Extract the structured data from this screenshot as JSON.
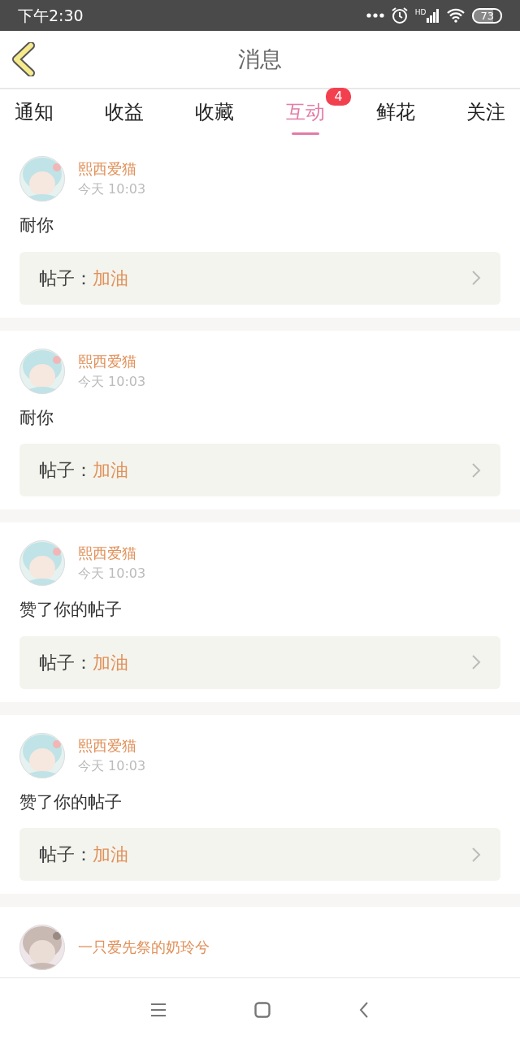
{
  "status_bar": {
    "time": "下午2:30",
    "network_label": "HD",
    "battery": "73"
  },
  "header": {
    "title": "消息"
  },
  "tabs": [
    {
      "label": "通知",
      "selected": false
    },
    {
      "label": "收益",
      "selected": false
    },
    {
      "label": "收藏",
      "selected": false
    },
    {
      "label": "互动",
      "selected": true,
      "badge": "4"
    },
    {
      "label": "鲜花",
      "selected": false
    },
    {
      "label": "关注",
      "selected": false
    }
  ],
  "messages": [
    {
      "user": "熙西爱猫",
      "time": "今天 10:03",
      "text": "耐你",
      "post_label": "帖子：",
      "post_title": "加油"
    },
    {
      "user": "熙西爱猫",
      "time": "今天 10:03",
      "text": "耐你",
      "post_label": "帖子：",
      "post_title": "加油"
    },
    {
      "user": "熙西爱猫",
      "time": "今天 10:03",
      "text": "赞了你的帖子",
      "post_label": "帖子：",
      "post_title": "加油"
    },
    {
      "user": "熙西爱猫",
      "time": "今天 10:03",
      "text": "赞了你的帖子",
      "post_label": "帖子：",
      "post_title": "加油"
    },
    {
      "user": "一只爱先祭的奶玲兮"
    }
  ]
}
